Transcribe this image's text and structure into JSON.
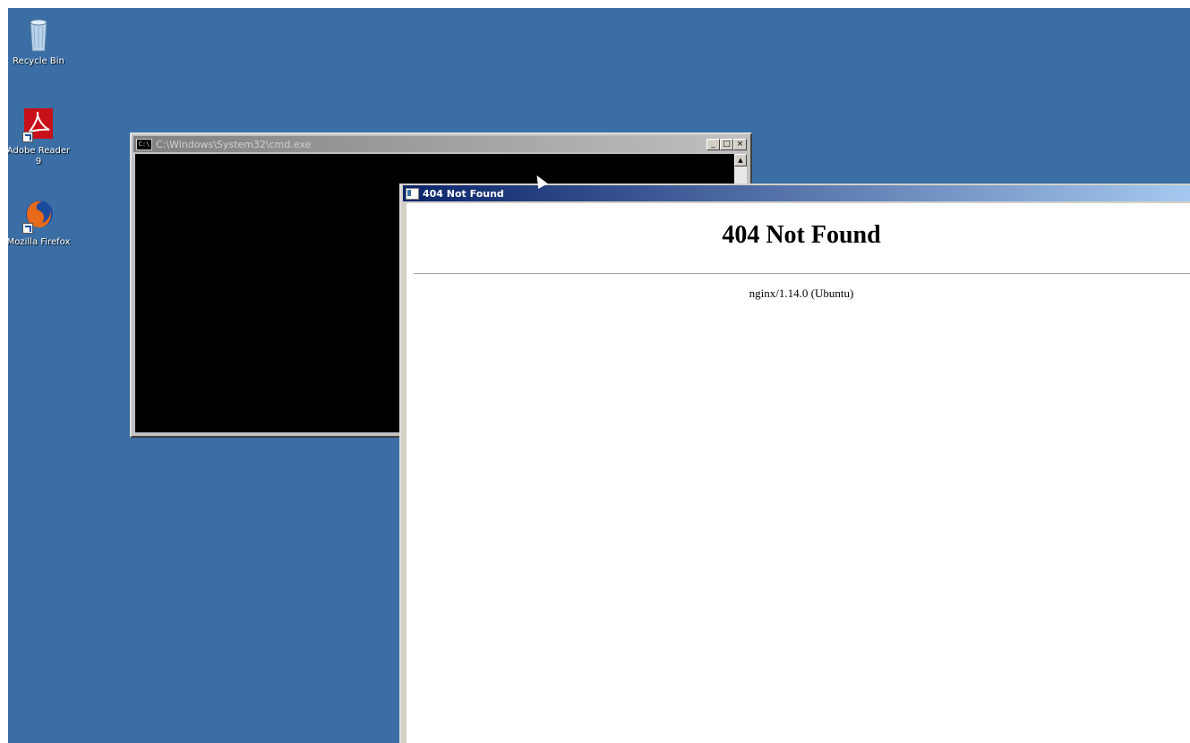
{
  "desktop": {
    "background_color": "#3a6ea5",
    "icons": [
      {
        "name": "recycle-bin",
        "label": "Recycle Bin",
        "icon": "recycle-bin-icon"
      },
      {
        "name": "adobe-reader",
        "label": "Adobe Reader 9",
        "icon": "adobe-reader-icon"
      },
      {
        "name": "mozilla-firefox",
        "label": "Mozilla Firefox",
        "icon": "firefox-icon"
      }
    ]
  },
  "cmd_window": {
    "title": "C:\\Windows\\System32\\cmd.exe",
    "icon_text": "C:\\",
    "buttons": {
      "minimize": "_",
      "maximize": "□",
      "close": "×"
    },
    "scroll_up": "▲"
  },
  "browser_window": {
    "title": "404 Not Found",
    "heading": "404 Not Found",
    "server_line": "nginx/1.14.0 (Ubuntu)"
  }
}
